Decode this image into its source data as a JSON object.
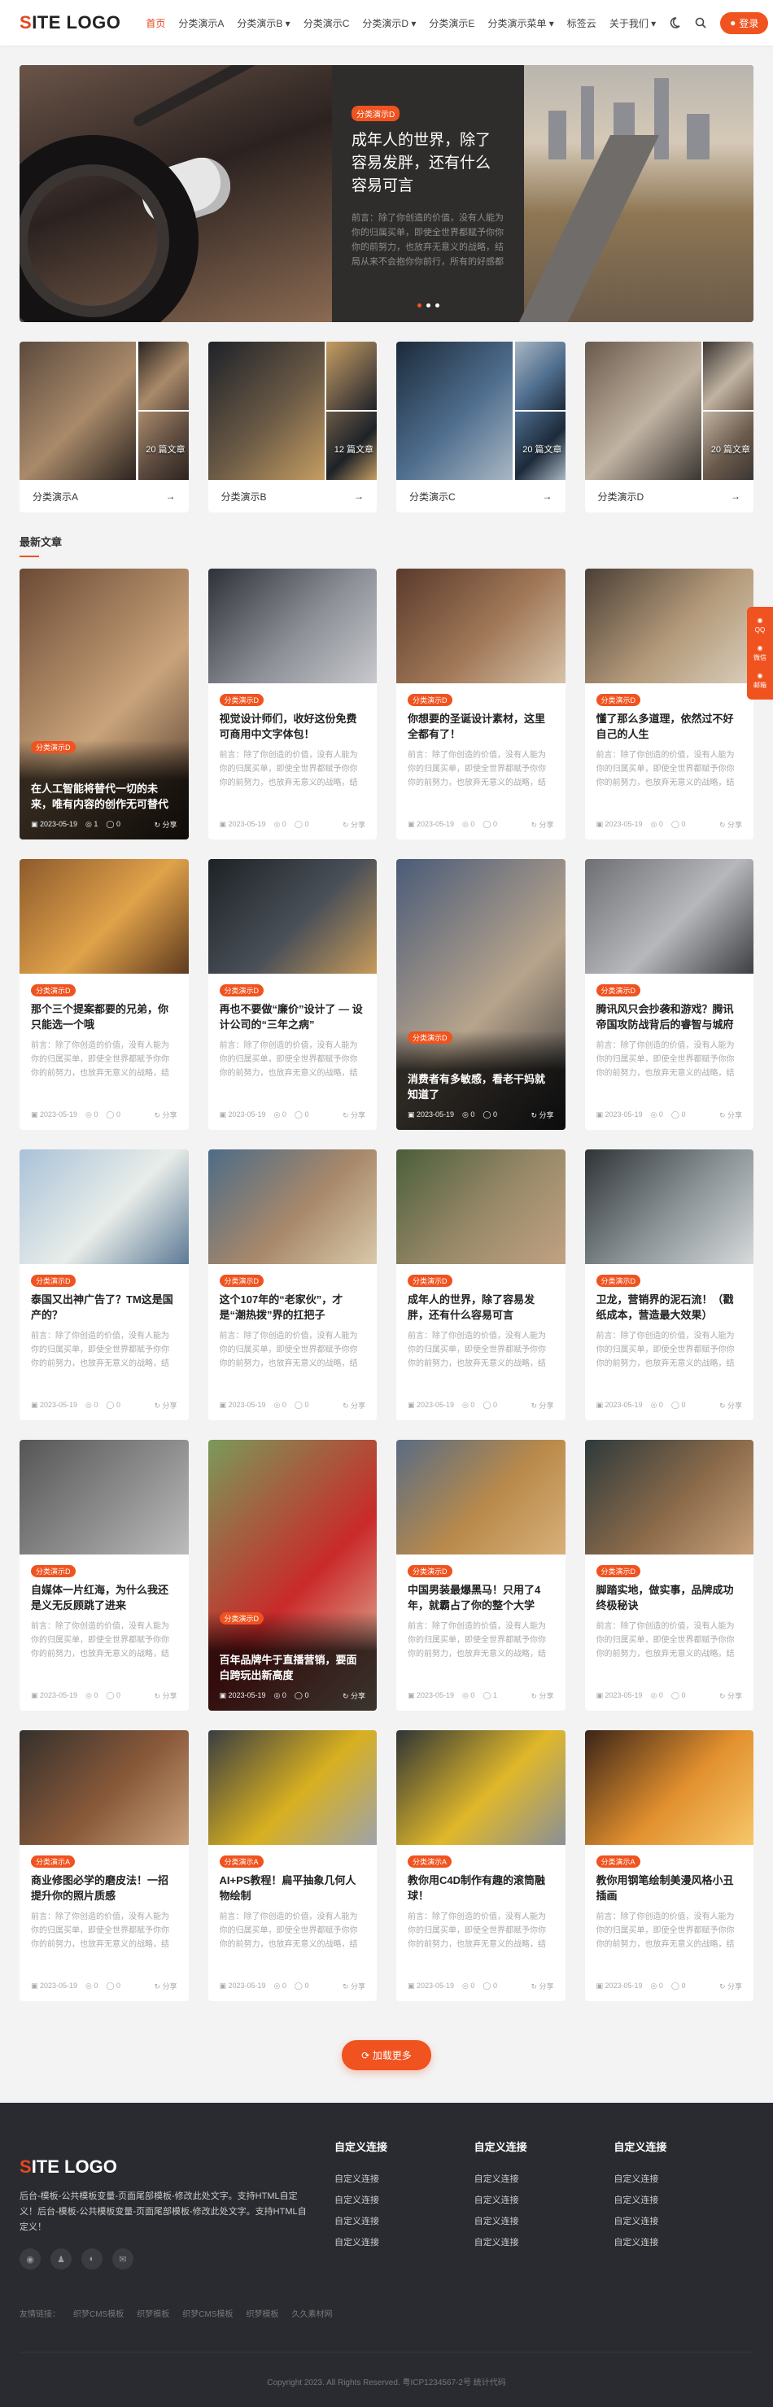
{
  "header": {
    "logo_first": "S",
    "logo_rest": "ITE LOGO",
    "nav": [
      "首页",
      "分类演示A",
      "分类演示B ▾",
      "分类演示C",
      "分类演示D ▾",
      "分类演示E",
      "分类演示菜单 ▾",
      "标签云",
      "关于我们 ▾"
    ],
    "login": "登录"
  },
  "hero": {
    "tag": "分类演示D",
    "title": "成年人的世界，除了容易发胖，还有什么容易可言",
    "excerpt": "前言：除了你创造的价值，没有人能为你的归属买单，即使全世界都赋予你你你的前努力，也放弃无意义的战略，结局从来不会抱你你前行，所有的好感都是以..."
  },
  "categories": [
    {
      "name": "分类演示A",
      "count": "20 篇文章"
    },
    {
      "name": "分类演示B",
      "count": "12 篇文章"
    },
    {
      "name": "分类演示C",
      "count": "20 篇文章"
    },
    {
      "name": "分类演示D",
      "count": "20 篇文章"
    }
  ],
  "section_title": "最新文章",
  "excerpt_common": "前言：除了你创造的价值，没有人能为你的归属买单，即使全世界都赋予你你你的前努力，也放弃无意义的战略，结局从来不会抱你你前行。所...",
  "meta": {
    "date": "2023-05-19",
    "views": "0",
    "comments": "0",
    "share": "分享"
  },
  "articles": [
    {
      "tag": "分类演示D",
      "title": "在人工智能将替代一切的未来，唯有内容的创作无可替代",
      "dark": true,
      "views": "1",
      "comments": "0"
    },
    {
      "tag": "分类演示D",
      "title": "视觉设计师们，收好这份免费可商用中文字体包！"
    },
    {
      "tag": "分类演示D",
      "title": "你想要的圣诞设计素材，这里全都有了！"
    },
    {
      "tag": "分类演示D",
      "title": "懂了那么多道理，依然过不好自己的人生"
    },
    {
      "tag": "分类演示D",
      "title": "那个三个提案都要的兄弟，你只能选一个哦"
    },
    {
      "tag": "分类演示D",
      "title": "再也不要做“廉价”设计了 — 设计公司的“三年之病”"
    },
    {
      "tag": "分类演示D",
      "title": "消费者有多敏感，看老干妈就知道了",
      "dark": true
    },
    {
      "tag": "分类演示D",
      "title": "腾讯风只会抄袭和游戏？腾讯帝国攻防战背后的睿智与城府"
    },
    {
      "tag": "分类演示D",
      "title": "泰国又出神广告了？TM这是国产的？"
    },
    {
      "tag": "分类演示D",
      "title": "这个107年的“老家伙”，才是“潮热拨”界的扛把子"
    },
    {
      "tag": "分类演示D",
      "title": "成年人的世界，除了容易发胖，还有什么容易可言"
    },
    {
      "tag": "分类演示D",
      "title": "卫龙，营销界的泥石流！（戳纸成本，营造最大效果）"
    },
    {
      "tag": "分类演示D",
      "title": "自媒体一片红海，为什么我还是义无反顾跳了进来"
    },
    {
      "tag": "分类演示D",
      "title": "百年品牌牛于直播营销，要面白跨玩出新高度",
      "dark": true
    },
    {
      "tag": "分类演示D",
      "title": "中国男装最爆黑马！只用了4年，就霸占了你的整个大学",
      "comments": "1"
    },
    {
      "tag": "分类演示D",
      "title": "脚踏实地，做实事，品牌成功终极秘诀"
    },
    {
      "tag": "分类演示A",
      "title": "商业修图必学的磨皮法！一招提升你的照片质感"
    },
    {
      "tag": "分类演示A",
      "title": "AI+PS教程！扁平抽象几何人物绘制"
    },
    {
      "tag": "分类演示A",
      "title": "教你用C4D制作有趣的滚筒融球！"
    },
    {
      "tag": "分类演示A",
      "title": "教你用钢笔绘制美漫风格小丑插画"
    }
  ],
  "load_more": "加载更多",
  "footer": {
    "logo_first": "S",
    "logo_rest": "ITE LOGO",
    "desc": "后台-模板-公共模板变量-页面尾部模板-修改此处文字。支持HTML自定义！后台-模板-公共模板变量-页面尾部模板-修改此处文字。支持HTML自定义！",
    "cols": [
      {
        "title": "自定义连接",
        "links": [
          "自定义连接",
          "自定义连接",
          "自定义连接",
          "自定义连接"
        ]
      },
      {
        "title": "自定义连接",
        "links": [
          "自定义连接",
          "自定义连接",
          "自定义连接",
          "自定义连接"
        ]
      },
      {
        "title": "自定义连接",
        "links": [
          "自定义连接",
          "自定义连接",
          "自定义连接",
          "自定义连接"
        ]
      }
    ],
    "friend_label": "友情链接：",
    "friend_links": [
      "织梦CMS模板",
      "织梦模板",
      "织梦CMS模板",
      "织梦模板",
      "久久素材网"
    ],
    "copyright": "Copyright 2023. All Rights Reserved. 粤ICP1234567-2号 统计代码"
  },
  "side": [
    "QQ",
    "微信",
    "邮箱"
  ],
  "colors": {
    "accent": "#f0531f",
    "footer_bg": "#2a2b30"
  }
}
